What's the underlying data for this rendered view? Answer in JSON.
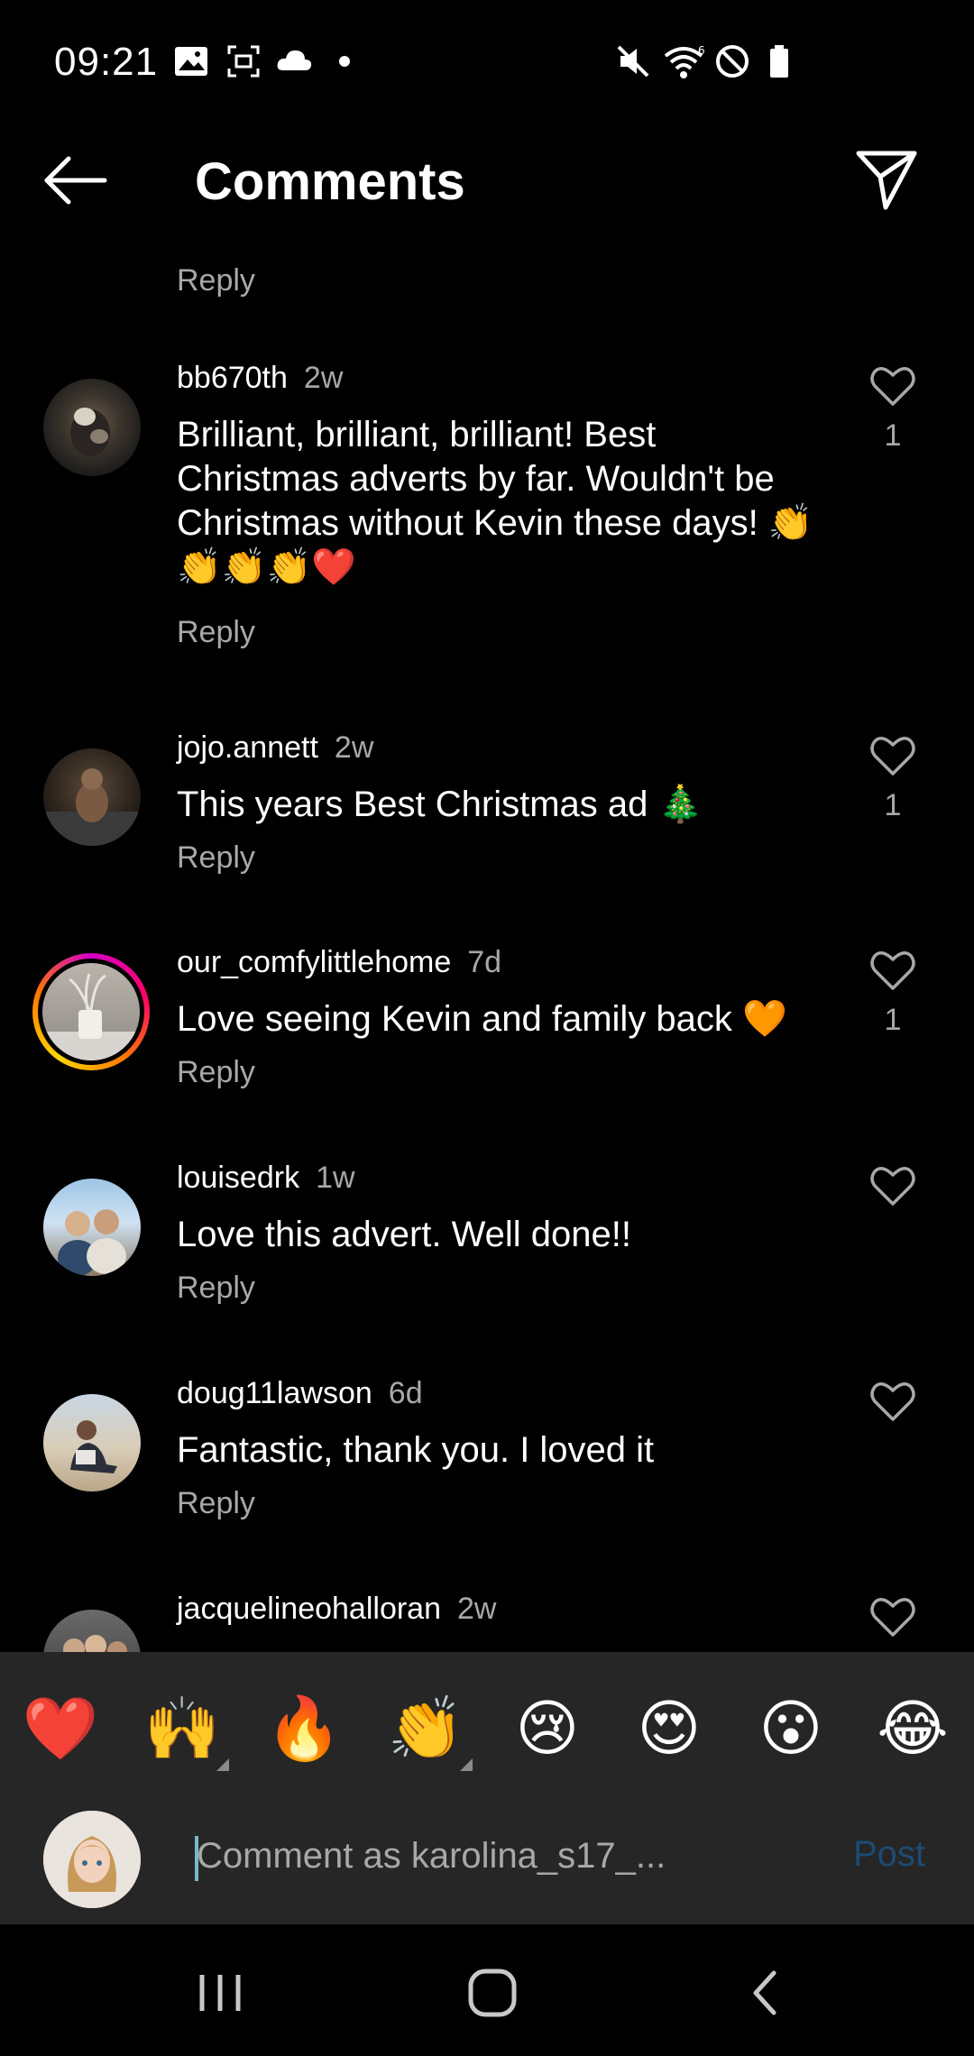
{
  "status_bar": {
    "time": "09:21",
    "icons": [
      "gallery-icon",
      "screen-capture-icon",
      "cloud-icon",
      "notification-dot-icon",
      "mute-icon",
      "wifi-icon",
      "no-disturb-icon",
      "battery-icon"
    ]
  },
  "header": {
    "title": "Comments",
    "back_icon": "arrow-left-icon",
    "share_icon": "send-icon"
  },
  "top_reply": "Reply",
  "comments": [
    {
      "username": "bb670th",
      "time": "2w",
      "text": "Brilliant, brilliant, brilliant! Best Christmas adverts by far. Wouldn't be Christmas without Kevin these days! 👏👏👏👏❤️",
      "likes": "1",
      "reply": "Reply"
    },
    {
      "username": "jojo.annett",
      "time": "2w",
      "text": "This years Best Christmas ad 🎄",
      "likes": "1",
      "reply": "Reply"
    },
    {
      "username": "our_comfylittlehome",
      "time": "7d",
      "text": "Love seeing Kevin and family back 🧡",
      "likes": "1",
      "reply": "Reply"
    },
    {
      "username": "louisedrk",
      "time": "1w",
      "text": "Love this advert. Well done!!",
      "likes": "",
      "reply": "Reply"
    },
    {
      "username": "doug11lawson",
      "time": "6d",
      "text": "Fantastic, thank you. I loved it",
      "likes": "",
      "reply": "Reply"
    },
    {
      "username": "jacquelineohalloran",
      "time": "2w",
      "text": "",
      "likes": "",
      "reply": ""
    }
  ],
  "emoji_bar": [
    "❤️",
    "🙌",
    "🔥",
    "👏",
    "😢",
    "😍",
    "😮",
    "😂"
  ],
  "composer": {
    "placeholder": "Comment as karolina_s17_...",
    "value": "",
    "post_label": "Post"
  },
  "nav_bar": {
    "icons": [
      "recent-apps-icon",
      "home-icon",
      "back-icon"
    ]
  },
  "colors": {
    "background": "#000000",
    "secondary_text": "#a8a8a8",
    "composer_background": "#262626",
    "post_disabled": "#1d4a72"
  }
}
